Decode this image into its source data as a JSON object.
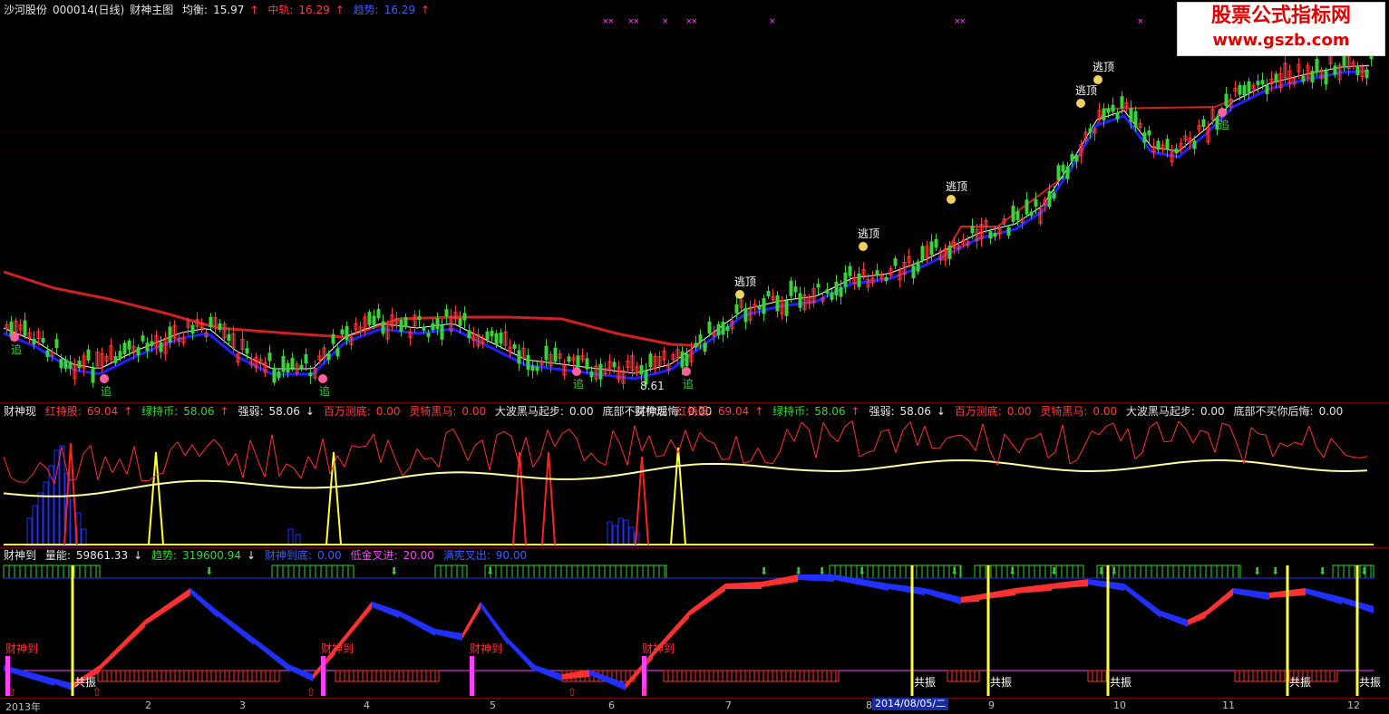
{
  "main": {
    "stock_name": "沙河股份",
    "stock_code": "000014(日线)",
    "formula": "财神主图",
    "balance_label": "均衡:",
    "balance_value": "15.97",
    "mid_label": "中轨:",
    "mid_value": "16.29",
    "trend_label": "趋势:",
    "trend_value": "16.29",
    "up_arrow": "↑",
    "low_price": "8.61",
    "escape_label": "逃顶",
    "chase_label": "追"
  },
  "ind1": {
    "name": "财神现",
    "red_hold_label": "红持股:",
    "red_hold_value": "69.04",
    "green_hold_label": "绿持币:",
    "green_hold_value": "58.06",
    "strength_label": "强弱:",
    "strength_value": "58.06",
    "million_label": "百万测底:",
    "million_value": "0.00",
    "horse_label": "灵犄黑马:",
    "horse_value": "0.00",
    "wave_label": "大波黑马起步:",
    "wave_value": "0.00",
    "regret_label": "底部不买你后悔:",
    "regret_value": "0.00",
    "down_arrow": "↓",
    "up_arrow": "↑"
  },
  "ind2": {
    "name": "财神到",
    "energy_label": "量能:",
    "energy_value": "59861.33",
    "trend_label": "趋势:",
    "trend_value": "319600.94",
    "arrive_label": "财神到底:",
    "arrive_value": "0.00",
    "gold_label": "低金叉进:",
    "gold_value": "20.00",
    "full_label": "满宪叉出:",
    "full_value": "90.00",
    "resonance_label": "共振",
    "wealth_label": "财神到",
    "down_arrow": "↓"
  },
  "xaxis": {
    "year": "2013年",
    "months": [
      "2",
      "3",
      "4",
      "5",
      "6",
      "7",
      "8",
      "9",
      "10",
      "11",
      "12"
    ],
    "cursor_date": "2014/08/05/二"
  },
  "watermark": {
    "line1": "股票公式指标网",
    "line2": "www.gszb.com"
  },
  "colors": {
    "up": "#ff3c3c",
    "down": "#3cd23c",
    "trend_line": "#2020ff",
    "mid_line": "#d02020",
    "balance_line": "#ffffff",
    "highlight": "#ffff40",
    "signal": "#ff40ff"
  }
}
